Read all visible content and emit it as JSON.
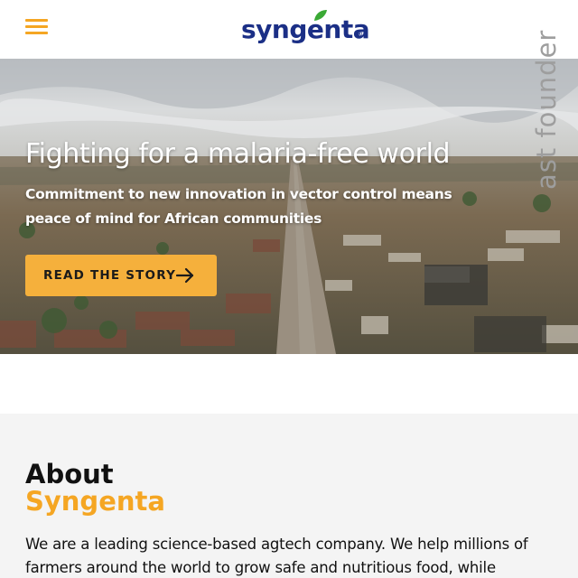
{
  "header": {
    "menu_icon": "hamburger-menu-icon",
    "logo_text": "syngenta",
    "logo_mark": "®",
    "side_text": "ast founder"
  },
  "hero": {
    "title": "Fighting for a malaria-free world",
    "subtitle": "Commitment to new innovation in vector control means peace of mind for African communities",
    "cta_label": "READ THE STORY",
    "cta_icon": "arrow-right-icon"
  },
  "about": {
    "title_line1": "About",
    "title_line2": "Syngenta",
    "body": "We are a leading science-based agtech company. We help millions of farmers around the world to grow safe and nutritious food, while"
  },
  "colors": {
    "brand_navy": "#1b2f86",
    "accent_orange": "#f5a623",
    "cta_bg": "#f5b03c",
    "leaf_green": "#3aa935",
    "about_bg": "#f4f4f4"
  }
}
